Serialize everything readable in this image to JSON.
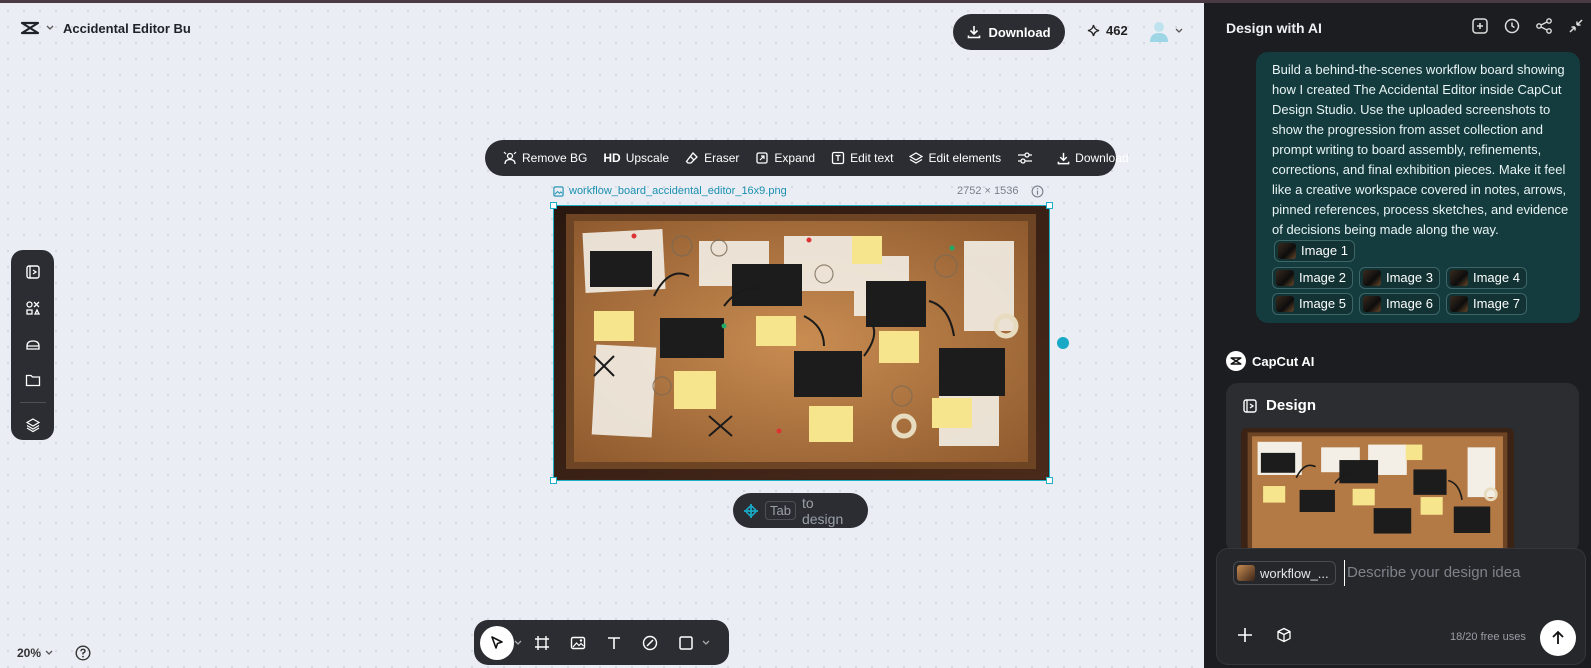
{
  "header": {
    "title": "Accidental Editor Bu",
    "download_label": "Download",
    "credits": "462"
  },
  "floating_toolbar": {
    "items": [
      {
        "label": "Remove BG",
        "icon": "remove-bg-icon"
      },
      {
        "label": "Upscale",
        "icon": "hd-icon",
        "prefix": "HD"
      },
      {
        "label": "Eraser",
        "icon": "eraser-icon"
      },
      {
        "label": "Expand",
        "icon": "expand-icon"
      },
      {
        "label": "Edit text",
        "icon": "edit-text-icon"
      },
      {
        "label": "Edit elements",
        "icon": "layers-icon"
      }
    ],
    "download_label": "Download"
  },
  "canvas": {
    "file_name": "workflow_board_accidental_editor_16x9.png",
    "dimensions": "2752 × 1536",
    "tab_key": "Tab",
    "tab_text": "to design",
    "zoom": "20%"
  },
  "panel": {
    "title": "Design with AI",
    "user_message": "Build a behind-the-scenes workflow board showing how I created The Accidental Editor inside CapCut Design Studio. Use the uploaded screenshots to show the progression from asset collection and prompt writing to board assembly, refinements, corrections, and final exhibition pieces. Make it feel like a creative workspace covered in notes, arrows, pinned references, process sketches, and evidence of decisions being made along the way.",
    "image_chips": [
      "Image 1",
      "Image 2",
      "Image 3",
      "Image 4",
      "Image 5",
      "Image 6",
      "Image 7"
    ],
    "ai_name": "CapCut AI",
    "design_label": "Design",
    "ref_chip": "workflow_...",
    "prompt_placeholder": "Describe your design idea",
    "free_uses": "18/20 free uses"
  },
  "colors": {
    "accent": "#1fb0c8",
    "dark_ui": "#2b2d33",
    "panel_bg": "#1c1d20",
    "user_bubble": "#143c3f"
  }
}
